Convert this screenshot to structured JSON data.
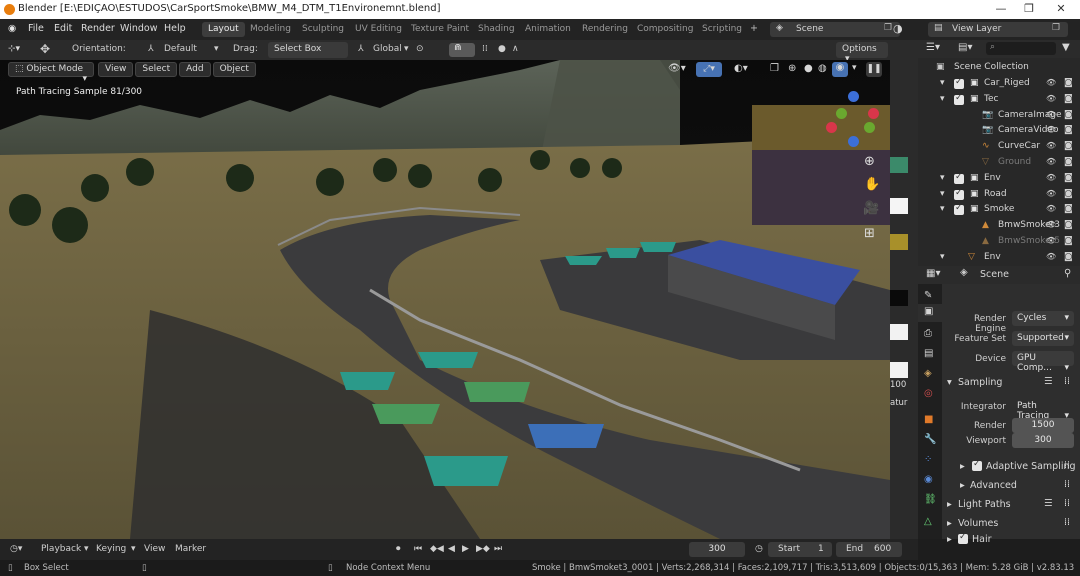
{
  "window": {
    "title": "Blender [E:\\EDIÇAO\\ESTUDOS\\CarSportSmoke\\BMW_M4_DTM_T1Environemnt.blend]",
    "controls": [
      "—",
      "❐",
      "✕"
    ]
  },
  "menu": {
    "items": [
      "File",
      "Edit",
      "Render",
      "Window",
      "Help"
    ],
    "workspaces": [
      "Layout",
      "Modeling",
      "Sculpting",
      "UV Editing",
      "Texture Paint",
      "Shading",
      "Animation",
      "Rendering",
      "Compositing",
      "Scripting"
    ],
    "active_workspace": "Layout",
    "add_tab": "+",
    "scene_name": "Scene",
    "view_layer": "View Layer"
  },
  "viewport_header": {
    "orientation_label": "Orientation:",
    "orientation_value": "Default",
    "drag_label": "Drag:",
    "drag_value": "Select Box",
    "transform_value": "Global",
    "options": "Options"
  },
  "viewport": {
    "mode": "Object Mode",
    "menus": [
      "View",
      "Select",
      "Add",
      "Object"
    ],
    "overlay_text": "Path Tracing Sample 81/300",
    "side_values": [
      "100",
      "atur"
    ]
  },
  "outliner": {
    "title": "Scene Collection",
    "rows": [
      {
        "name": "Car_Riged",
        "level": 1,
        "kind": "collection"
      },
      {
        "name": "Tec",
        "level": 1,
        "kind": "collection"
      },
      {
        "name": "CameraImage",
        "level": 2,
        "kind": "camera"
      },
      {
        "name": "CameraVideo",
        "level": 2,
        "kind": "camera"
      },
      {
        "name": "CurveCar",
        "level": 2,
        "kind": "curve"
      },
      {
        "name": "Ground",
        "level": 2,
        "kind": "mesh-disabled"
      },
      {
        "name": "Env",
        "level": 1,
        "kind": "collection"
      },
      {
        "name": "Road",
        "level": 1,
        "kind": "collection"
      },
      {
        "name": "Smoke",
        "level": 1,
        "kind": "collection"
      },
      {
        "name": "BmwSmoket3",
        "level": 2,
        "kind": "smoke"
      },
      {
        "name": "BmwSmoket5",
        "level": 2,
        "kind": "smoke-disabled"
      },
      {
        "name": "Env",
        "level": 1,
        "kind": "object"
      }
    ]
  },
  "properties": {
    "context": "Scene",
    "render_engine_label": "Render Engine",
    "render_engine": "Cycles",
    "feature_set_label": "Feature Set",
    "feature_set": "Supported",
    "device_label": "Device",
    "device": "GPU Comp...",
    "sampling_panel": "Sampling",
    "integrator_label": "Integrator",
    "integrator": "Path Tracing",
    "render_label": "Render",
    "render_samples": "1500",
    "viewport_label": "Viewport",
    "viewport_samples": "300",
    "adaptive_sampling": "Adaptive Sampling",
    "advanced": "Advanced",
    "light_paths": "Light Paths",
    "volumes": "Volumes",
    "hair": "Hair"
  },
  "timeline": {
    "playback": "Playback",
    "keying": "Keying",
    "view": "View",
    "marker": "Marker",
    "current_frame": "300",
    "start_label": "Start",
    "start": "1",
    "end_label": "End",
    "end": "600"
  },
  "statusbar": {
    "left": "Box Select",
    "middle": "Node Context Menu",
    "right": "Smoke | BmwSmoket3_0001 | Verts:2,268,314 | Faces:2,109,717 | Tris:3,513,609 | Objects:0/15,363 | Mem: 5.28 GiB | v2.83.13"
  },
  "colors": {
    "accent": "#4772b3",
    "ground": "#6e6440",
    "road": "#3a3a3c",
    "tent_teal": "#2b9a8a",
    "tent_green": "#4a9a5c",
    "tent_blue": "#3c6fb8",
    "grandstand": "#3a4fa0"
  }
}
